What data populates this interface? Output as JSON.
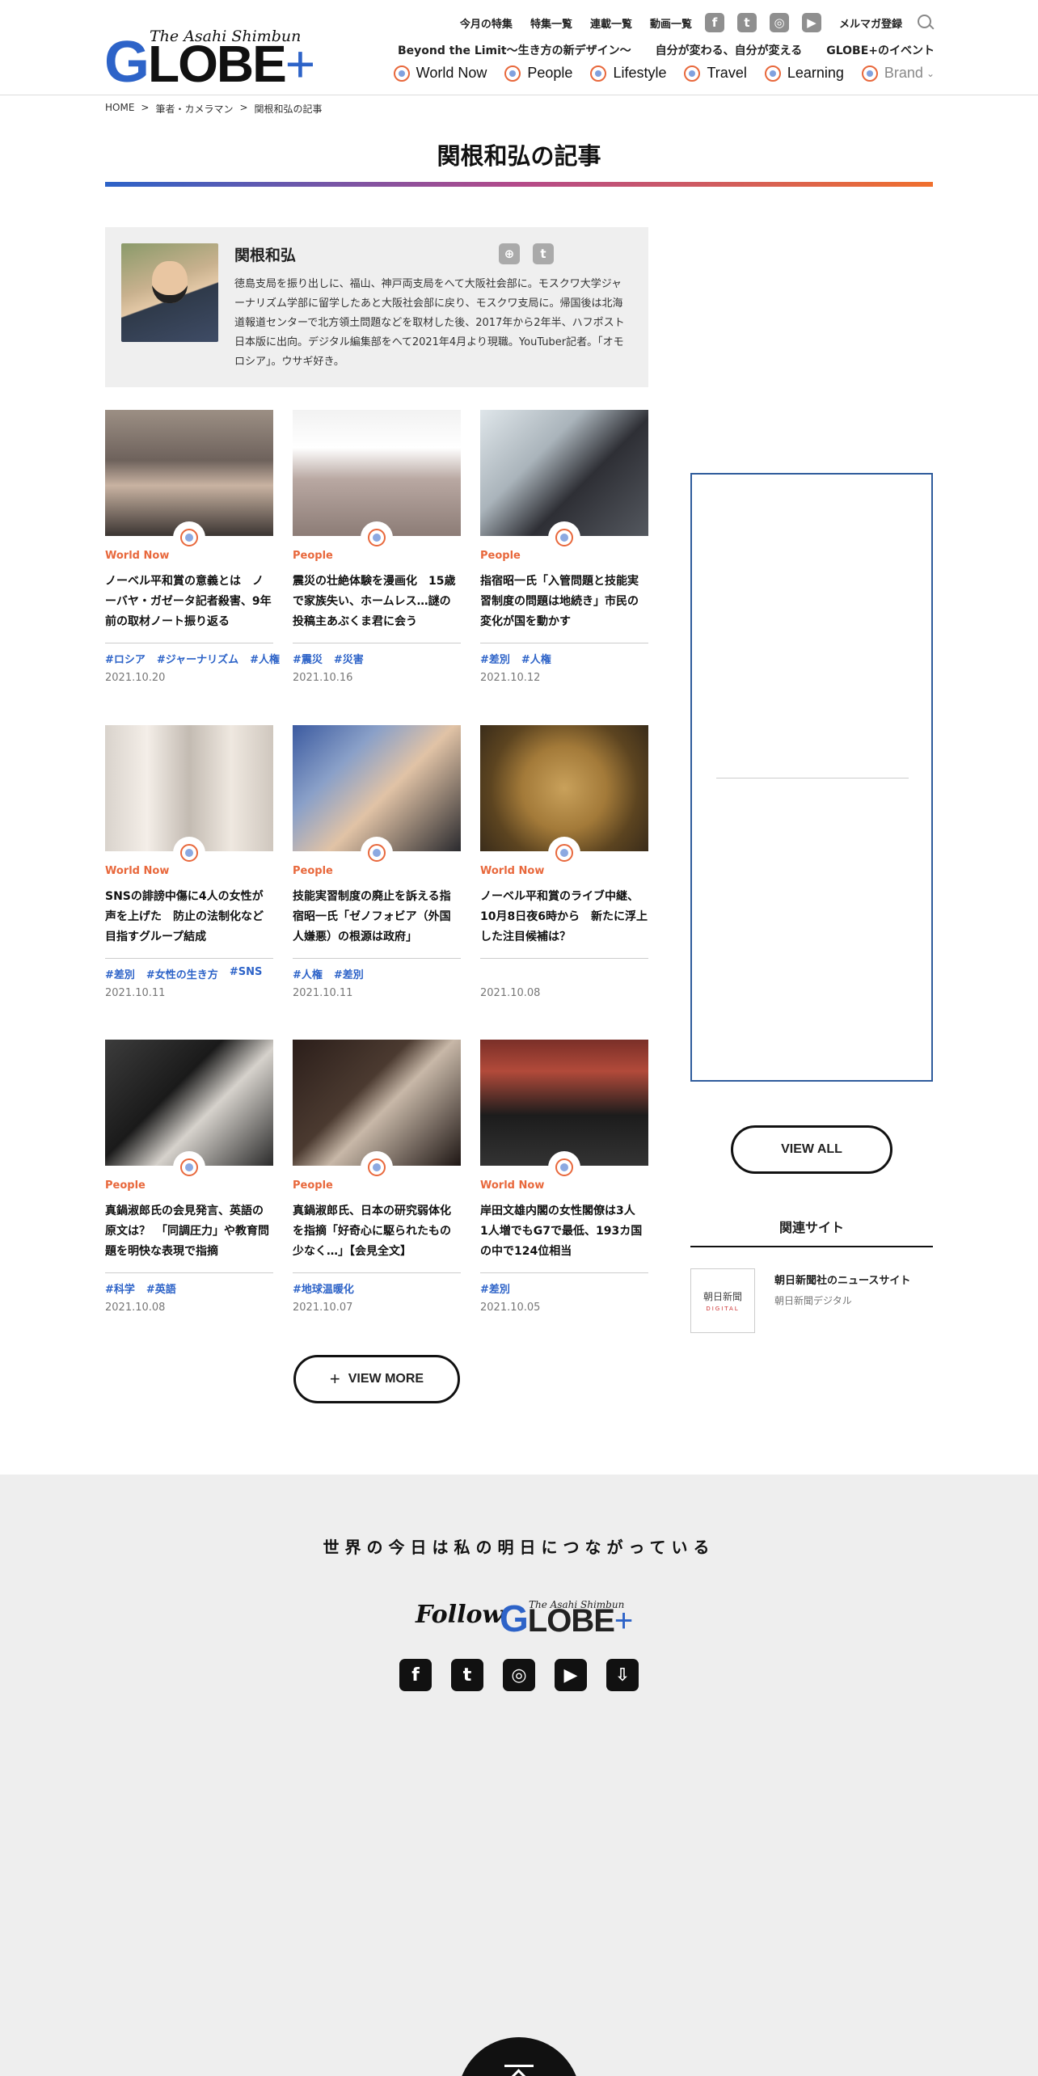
{
  "header": {
    "logo_super": "The Asahi Shimbun",
    "logo_main": "LOBE",
    "logo_g": "G",
    "logo_plus": "+",
    "toplinks": [
      "今月の特集",
      "特集一覧",
      "連載一覧",
      "動画一覧"
    ],
    "mailmag": "メルマガ登録",
    "row2": [
      "Beyond the Limit～生き方の新デザイン～",
      "自分が変わる、自分が変える",
      "GLOBE+のイベント"
    ],
    "nav": [
      "World Now",
      "People",
      "Lifestyle",
      "Travel",
      "Learning",
      "Brand"
    ]
  },
  "breadcrumb": [
    "HOME",
    ">",
    "筆者・カメラマン",
    ">",
    "関根和弘の記事"
  ],
  "page_title": "関根和弘の記事",
  "profile": {
    "name": "関根和弘",
    "bio": "徳島支局を振り出しに、福山、神戸両支局をへて大阪社会部に。モスクワ大学ジャーナリズム学部に留学したあと大阪社会部に戻り、モスクワ支局に。帰国後は北海道報道センターで北方領土問題などを取材した後、2017年から2年半、ハフポスト日本版に出向。デジタル編集部をへて2021年4月より現職。YouTuber記者。「オモロシア」。ウサギ好き。"
  },
  "articles": [
    {
      "category": "World Now",
      "title": "ノーベル平和賞の意義とは　ノーバヤ・ガゼータ記者殺害、9年前の取材ノート振り返る",
      "tags": [
        "#ロシア",
        "#ジャーナリズム",
        "#人権"
      ],
      "date": "2021.10.20"
    },
    {
      "category": "People",
      "title": "震災の壮絶体験を漫画化　15歳で家族失い、ホームレス…謎の投稿主あぶくま君に会う",
      "tags": [
        "#震災",
        "#災害"
      ],
      "date": "2021.10.16"
    },
    {
      "category": "People",
      "title": "指宿昭一氏「入管問題と技能実習制度の問題は地続き」市民の変化が国を動かす",
      "tags": [
        "#差別",
        "#人権"
      ],
      "date": "2021.10.12"
    },
    {
      "category": "World Now",
      "title": "SNSの誹謗中傷に4人の女性が声を上げた　防止の法制化など目指すグループ結成",
      "tags": [
        "#差別",
        "#女性の生き方",
        "#SNS"
      ],
      "date": "2021.10.11"
    },
    {
      "category": "People",
      "title": "技能実習制度の廃止を訴える指宿昭一氏「ゼノフォビア（外国人嫌悪）の根源は政府」",
      "tags": [
        "#人権",
        "#差別"
      ],
      "date": "2021.10.11"
    },
    {
      "category": "World Now",
      "title": "ノーベル平和賞のライブ中継、10月8日夜6時から　新たに浮上した注目候補は？",
      "tags": [],
      "date": "2021.10.08"
    },
    {
      "category": "People",
      "title": "真鍋淑郎氏の会見発言、英語の原文は？　「同調圧力」や教育問題を明快な表現で指摘",
      "tags": [
        "#科学",
        "#英語"
      ],
      "date": "2021.10.08"
    },
    {
      "category": "People",
      "title": "真鍋淑郎氏、日本の研究弱体化を指摘「好奇心に駆られたもの少なく…」【会見全文】",
      "tags": [
        "#地球温暖化"
      ],
      "date": "2021.10.07"
    },
    {
      "category": "World Now",
      "title": "岸田文雄内閣の女性閣僚は3人　1人増でもG7で最低、193カ国の中で124位相当",
      "tags": [
        "#差別"
      ],
      "date": "2021.10.05"
    }
  ],
  "view_more": "VIEW MORE",
  "view_all": "VIEW ALL",
  "related": {
    "heading": "関連サイト",
    "logo_text": "朝日新聞",
    "logo_sub": "DIGITAL",
    "title": "朝日新聞社のニュースサイト",
    "sub": "朝日新聞デジタル"
  },
  "footer": {
    "tagline": "世界の今日は私の明日につながっている",
    "follow": "Follow",
    "logo_super": "The Asahi Shimbun",
    "logo_g": "G",
    "logo_main": "LOBE",
    "logo_plus": "+"
  },
  "colors": {
    "accent_blue": "#2d63c8",
    "accent_orange": "#e8683c"
  }
}
